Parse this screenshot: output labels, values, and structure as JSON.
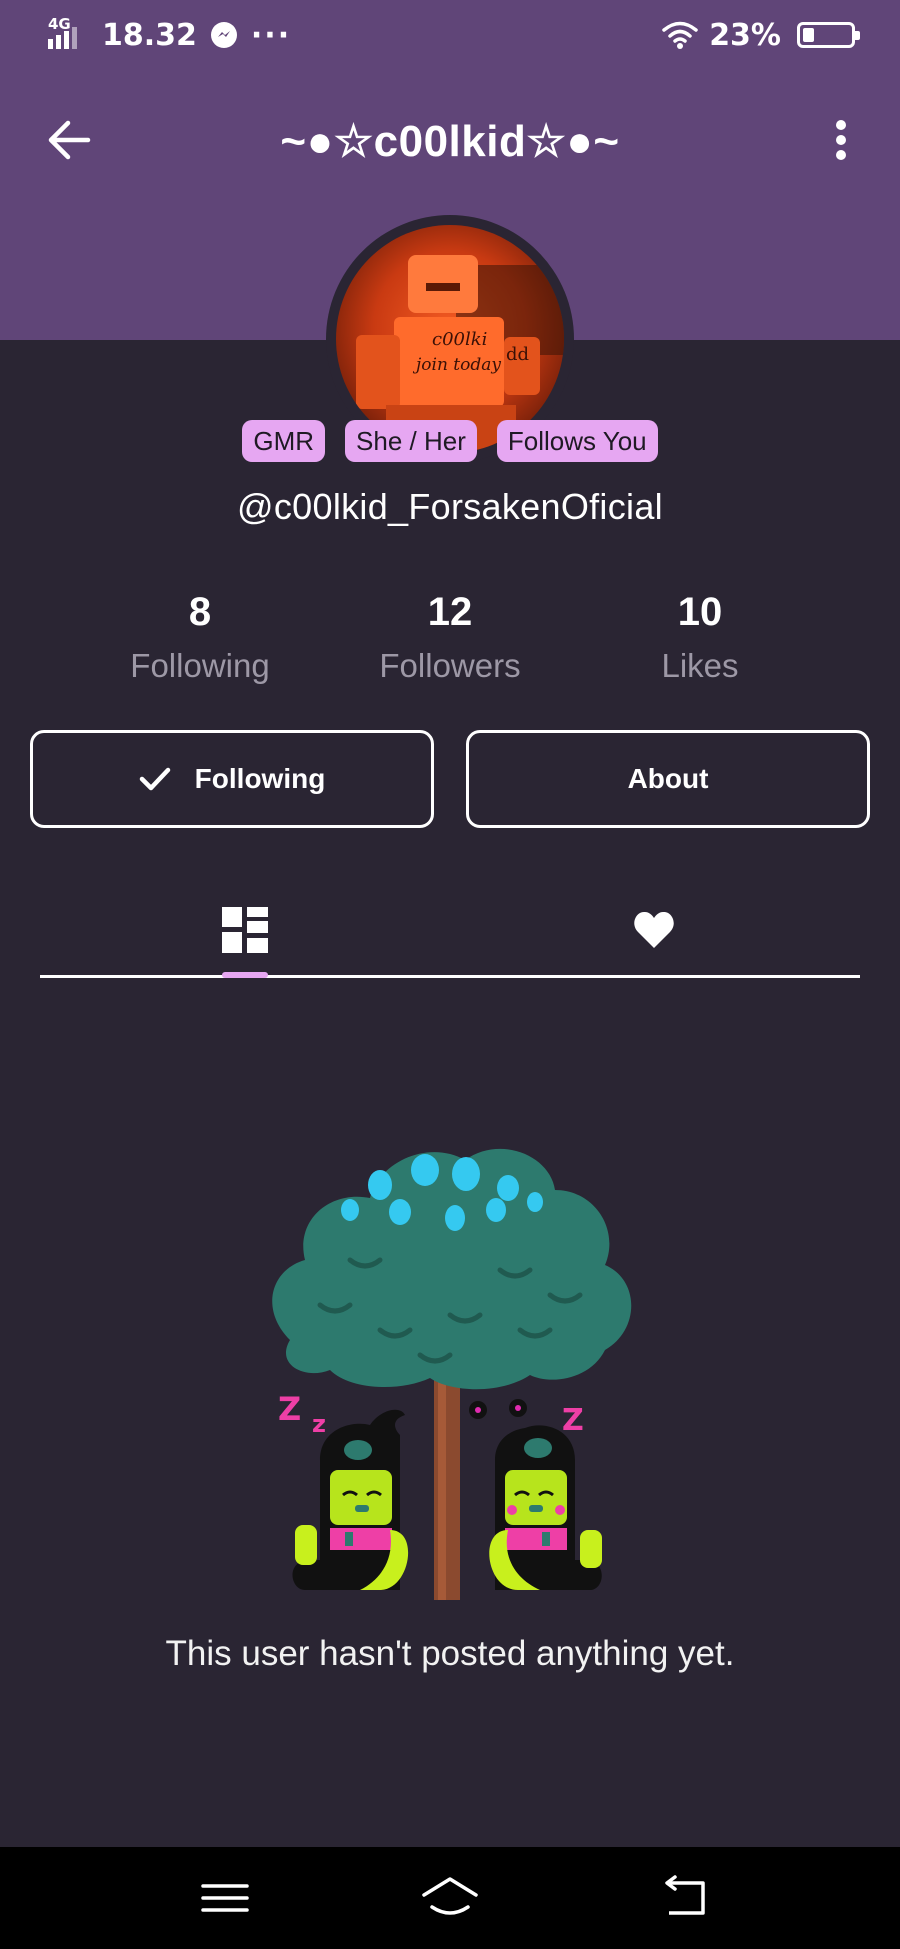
{
  "status_bar": {
    "network": "4G",
    "time": "18.32",
    "overflow": "···",
    "battery": "23%",
    "icons": [
      "signal-icon",
      "messenger-icon",
      "wifi-icon",
      "battery-icon"
    ]
  },
  "header": {
    "title": "~●☆c00lkid☆●~",
    "back_icon": "arrow-left-icon",
    "more_icon": "vertical-dots-icon",
    "background": "#604578"
  },
  "profile": {
    "badges": [
      "GMR",
      "She / Her",
      "Follows You"
    ],
    "username": "@c00lkid_ForsakenOficial",
    "avatar_text": [
      "c00lki",
      "join today",
      "dd"
    ]
  },
  "stats": [
    {
      "value": "8",
      "label": "Following"
    },
    {
      "value": "12",
      "label": "Followers"
    },
    {
      "value": "10",
      "label": "Likes"
    }
  ],
  "actions": {
    "following_label": "Following",
    "about_label": "About"
  },
  "tabs": {
    "items": [
      {
        "icon": "grid-layout-icon",
        "selected": true
      },
      {
        "icon": "heart-icon",
        "selected": false
      }
    ]
  },
  "empty_state": {
    "message": "This user hasn't posted anything yet.",
    "sleep_marks": [
      "Z",
      "z",
      "Z"
    ]
  },
  "nav_bar": {
    "icons": [
      "menu-icon",
      "home-icon",
      "back-icon"
    ]
  },
  "colors": {
    "background": "#2a2533",
    "header": "#604578",
    "accent": "#e6a7f2",
    "muted_text": "#9d98a6"
  }
}
